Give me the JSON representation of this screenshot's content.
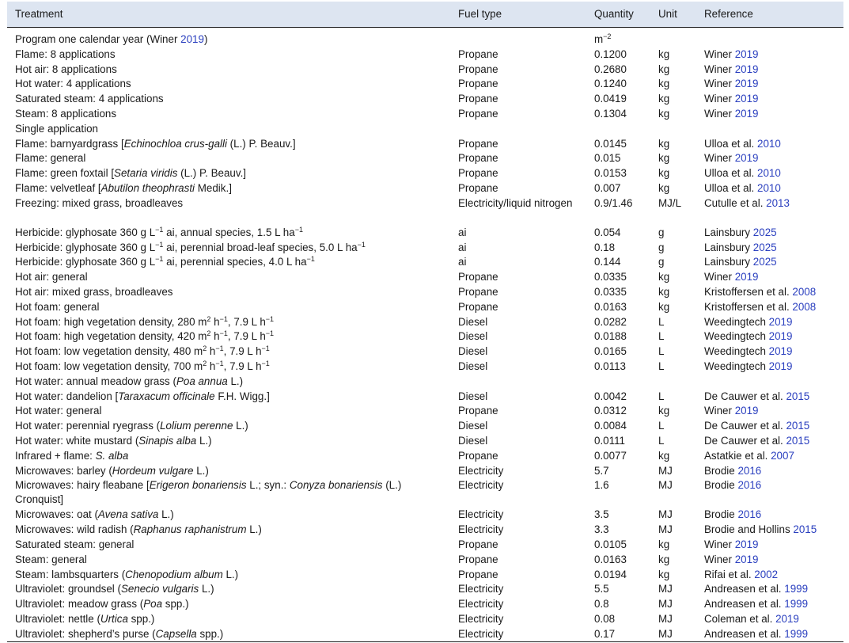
{
  "headers": {
    "treatment": "Treatment",
    "fuel": "Fuel type",
    "quantity": "Quantity",
    "unit": "Unit",
    "reference": "Reference"
  },
  "rows": [
    {
      "t": "Program one calendar year (Winer ",
      "ty": "2019",
      "ta": ")",
      "f": "",
      "q": "m",
      "qsup": "−2",
      "u": "",
      "ra": "",
      "ry": ""
    },
    {
      "t": "Flame: 8 applications",
      "f": "Propane",
      "q": "0.1200",
      "u": "kg",
      "ra": "Winer ",
      "ry": "2019"
    },
    {
      "t": "Hot air: 8 applications",
      "f": "Propane",
      "q": "0.2680",
      "u": "kg",
      "ra": "Winer ",
      "ry": "2019"
    },
    {
      "t": "Hot water: 4 applications",
      "f": "Propane",
      "q": "0.1240",
      "u": "kg",
      "ra": "Winer ",
      "ry": "2019"
    },
    {
      "t": "Saturated steam: 4 applications",
      "f": "Propane",
      "q": "0.0419",
      "u": "kg",
      "ra": "Winer ",
      "ry": "2019"
    },
    {
      "t": "Steam: 8 applications",
      "f": "Propane",
      "q": "0.1304",
      "u": "kg",
      "ra": "Winer ",
      "ry": "2019"
    },
    {
      "t": "Single application",
      "f": "",
      "q": "",
      "u": "",
      "ra": "",
      "ry": ""
    },
    {
      "t": "Flame: barnyardgrass [",
      "ti": "Echinochloa crus-galli",
      "ta": " (L.) P. Beauv.]",
      "f": "Propane",
      "q": "0.0145",
      "u": "kg",
      "ra": "Ulloa et al. ",
      "ry": "2010"
    },
    {
      "t": "Flame: general",
      "f": "Propane",
      "q": "0.015",
      "u": "kg",
      "ra": "Winer ",
      "ry": "2019"
    },
    {
      "t": "Flame: green foxtail [",
      "ti": "Setaria viridis",
      "ta": " (L.) P. Beauv.]",
      "f": "Propane",
      "q": "0.0153",
      "u": "kg",
      "ra": "Ulloa et al. ",
      "ry": "2010"
    },
    {
      "t": "Flame: velvetleaf [",
      "ti": "Abutilon theophrasti",
      "ta": " Medik.]",
      "f": "Propane",
      "q": "0.007",
      "u": "kg",
      "ra": "Ulloa et al. ",
      "ry": "2010"
    },
    {
      "t": "Freezing: mixed grass, broadleaves",
      "f": "Electricity/liquid nitrogen",
      "q": "0.9/1.46",
      "u": "MJ/L",
      "ra": "Cutulle et al. ",
      "ry": "2013",
      "tall": true
    },
    {
      "t": "Herbicide: glyphosate 360 g L",
      "s1": "−1",
      "t2": " ai, annual species, 1.5 L ha",
      "s2": "−1",
      "f": "ai",
      "q": "0.054",
      "u": "g",
      "ra": "Lainsbury ",
      "ry": "2025"
    },
    {
      "t": "Herbicide: glyphosate 360 g L",
      "s1": "−1",
      "t2": " ai, perennial broad-leaf species, 5.0 L ha",
      "s2": "−1",
      "f": "ai",
      "q": "0.18",
      "u": "g",
      "ra": "Lainsbury ",
      "ry": "2025"
    },
    {
      "t": "Herbicide: glyphosate 360 g L",
      "s1": "−1",
      "t2": " ai, perennial species, 4.0 L ha",
      "s2": "−1",
      "f": "ai",
      "q": "0.144",
      "u": "g",
      "ra": "Lainsbury ",
      "ry": "2025"
    },
    {
      "t": "Hot air: general",
      "f": "Propane",
      "q": "0.0335",
      "u": "kg",
      "ra": "Winer ",
      "ry": "2019"
    },
    {
      "t": "Hot air: mixed grass, broadleaves",
      "f": "Propane",
      "q": "0.0335",
      "u": "kg",
      "ra": "Kristoffersen et al. ",
      "ry": "2008"
    },
    {
      "t": "Hot foam: general",
      "f": "Propane",
      "q": "0.0163",
      "u": "kg",
      "ra": "Kristoffersen et al. ",
      "ry": "2008"
    },
    {
      "t": "Hot foam: high vegetation density, 280 m",
      "s1": "2",
      "t2": " h",
      "s2": "−1",
      "t3": ", 7.9 L h",
      "s3": "−1",
      "f": "Diesel",
      "q": "0.0282",
      "u": "L",
      "ra": "Weedingtech ",
      "ry": "2019"
    },
    {
      "t": "Hot foam: high vegetation density, 420 m",
      "s1": "2",
      "t2": " h",
      "s2": "−1",
      "t3": ", 7.9 L h",
      "s3": "−1",
      "f": "Diesel",
      "q": "0.0188",
      "u": "L",
      "ra": "Weedingtech ",
      "ry": "2019"
    },
    {
      "t": "Hot foam: low vegetation density, 480 m",
      "s1": "2",
      "t2": " h",
      "s2": "−1",
      "t3": ", 7.9 L h",
      "s3": "−1",
      "f": "Diesel",
      "q": "0.0165",
      "u": "L",
      "ra": "Weedingtech ",
      "ry": "2019"
    },
    {
      "t": "Hot foam: low vegetation density, 700 m",
      "s1": "2",
      "t2": " h",
      "s2": "−1",
      "t3": ", 7.9 L h",
      "s3": "−1",
      "f": "Diesel",
      "q": "0.0113",
      "u": "L",
      "ra": "Weedingtech ",
      "ry": "2019"
    },
    {
      "t": "Hot water: annual meadow grass (",
      "ti": "Poa annua",
      "ta": " L.)",
      "f": "",
      "q": "",
      "u": "",
      "ra": "",
      "ry": ""
    },
    {
      "t": "Hot water: dandelion [",
      "ti": "Taraxacum officinale",
      "ta": " F.H. Wigg.]",
      "f": "Diesel",
      "q": "0.0042",
      "u": "L",
      "ra": "De Cauwer et al. ",
      "ry": "2015"
    },
    {
      "t": "Hot water: general",
      "f": "Propane",
      "q": "0.0312",
      "u": "kg",
      "ra": "Winer ",
      "ry": "2019"
    },
    {
      "t": "Hot water: perennial ryegrass (",
      "ti": "Lolium perenne",
      "ta": " L.)",
      "f": "Diesel",
      "q": "0.0084",
      "u": "L",
      "ra": "De Cauwer et al. ",
      "ry": "2015"
    },
    {
      "t": "Hot water: white mustard (",
      "ti": "Sinapis alba",
      "ta": " L.)",
      "f": "Diesel",
      "q": "0.0111",
      "u": "L",
      "ra": "De Cauwer et al. ",
      "ry": "2015"
    },
    {
      "t": "Infrared + flame: ",
      "ti": "S. alba",
      "ta": "",
      "f": "Propane",
      "q": "0.0077",
      "u": "kg",
      "ra": "Astatkie et al. ",
      "ry": "2007"
    },
    {
      "t": "Microwaves: barley (",
      "ti": "Hordeum vulgare",
      "ta": " L.)",
      "f": "Electricity",
      "q": "5.7",
      "u": "MJ",
      "ra": "Brodie ",
      "ry": "2016"
    },
    {
      "t": "Microwaves: hairy fleabane [",
      "ti": "Erigeron bonariensis",
      "ta": " L.; syn.: ",
      "ti2": "Conyza bonariensis",
      "ta2": " (L.) Cronquist]",
      "f": "Electricity",
      "q": "1.6",
      "u": "MJ",
      "ra": "Brodie ",
      "ry": "2016",
      "tall": true
    },
    {
      "t": "Microwaves: oat (",
      "ti": "Avena sativa",
      "ta": " L.)",
      "f": "Electricity",
      "q": "3.5",
      "u": "MJ",
      "ra": "Brodie ",
      "ry": "2016"
    },
    {
      "t": "Microwaves: wild radish (",
      "ti": "Raphanus raphanistrum",
      "ta": " L.)",
      "f": "Electricity",
      "q": "3.3",
      "u": "MJ",
      "ra": "Brodie and Hollins ",
      "ry": "2015"
    },
    {
      "t": "Saturated steam: general",
      "f": "Propane",
      "q": "0.0105",
      "u": "kg",
      "ra": "Winer ",
      "ry": "2019"
    },
    {
      "t": "Steam: general",
      "f": "Propane",
      "q": "0.0163",
      "u": "kg",
      "ra": "Winer ",
      "ry": "2019"
    },
    {
      "t": "Steam: lambsquarters (",
      "ti": "Chenopodium album",
      "ta": " L.)",
      "f": "Propane",
      "q": "0.0194",
      "u": "kg",
      "ra": "Rifai et al. ",
      "ry": "2002"
    },
    {
      "t": "Ultraviolet: groundsel (",
      "ti": "Senecio vulgaris",
      "ta": " L.)",
      "f": "Electricity",
      "q": "5.5",
      "u": "MJ",
      "ra": "Andreasen et al. ",
      "ry": "1999"
    },
    {
      "t": "Ultraviolet: meadow grass (",
      "ti": "Poa",
      "ta": " spp.)",
      "f": "Electricity",
      "q": "0.8",
      "u": "MJ",
      "ra": "Andreasen et al. ",
      "ry": "1999"
    },
    {
      "t": "Ultraviolet: nettle (",
      "ti": "Urtica",
      "ta": " spp.)",
      "f": "Electricity",
      "q": "0.08",
      "u": "MJ",
      "ra": "Coleman et al. ",
      "ry": "2019"
    },
    {
      "t": "Ultraviolet: shepherd’s purse (",
      "ti": "Capsella",
      "ta": " spp.)",
      "f": "Electricity",
      "q": "0.17",
      "u": "MJ",
      "ra": "Andreasen et al. ",
      "ry": "1999"
    }
  ]
}
